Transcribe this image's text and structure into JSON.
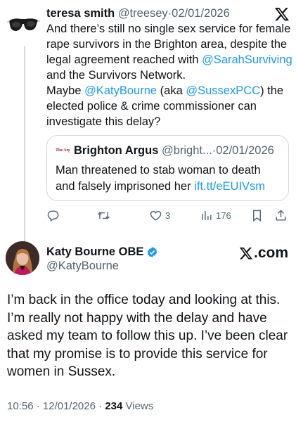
{
  "parent_tweet": {
    "author_name": "teresa smith",
    "handle": "@treesey",
    "separator": "·",
    "date": "02/01/2026",
    "body_lines": [
      [
        "And there’s still no single sex service for female"
      ],
      [
        "rape survivors in the Brighton area, despite the"
      ],
      [
        "legal agreement reached with ",
        "@SarahSurviving"
      ],
      [
        "and the Survivors Network."
      ],
      [
        "Maybe ",
        "@KatyBourne",
        " (aka ",
        "@SussexPCC",
        ") the"
      ],
      [
        "elected police & crime commissioner can"
      ],
      [
        "investigate this delay?"
      ]
    ],
    "quote": {
      "logo_text": "The Argus",
      "author_name": "Brighton Argus",
      "handle": "@bright...",
      "separator": "·",
      "date": "02/01/2026",
      "line1": "Man threatened to stab woman to death",
      "line2_text": "and falsely imprisoned her ",
      "line2_link": "ift.tt/eEUIVsm"
    },
    "actions": {
      "reply_count": "",
      "retweet_count": "",
      "like_count": "3",
      "views_count": "176"
    }
  },
  "main_tweet": {
    "author_name": "Katy Bourne OBE",
    "handle": "@KatyBourne",
    "brand": ".com",
    "body_lines": [
      "I’m back in the office today and looking at this.",
      "I’m really not happy with the delay and have",
      "asked my team to follow this up. I’ve been clear",
      "that my promise is to provide this service for",
      "women in Sussex."
    ],
    "time": "10:56",
    "date": "12/01/2026",
    "separator": "·",
    "views_count": "234",
    "views_label": "Views"
  },
  "colors": {
    "link": "#1d9bf0",
    "muted": "#536471",
    "verified": "#1d9bf0",
    "border": "#cfd9de"
  },
  "icons": [
    "sunglasses-avatar",
    "x-logo-icon",
    "reply-icon",
    "retweet-icon",
    "like-icon",
    "views-icon",
    "bookmark-icon",
    "share-icon",
    "verified-badge-icon"
  ]
}
